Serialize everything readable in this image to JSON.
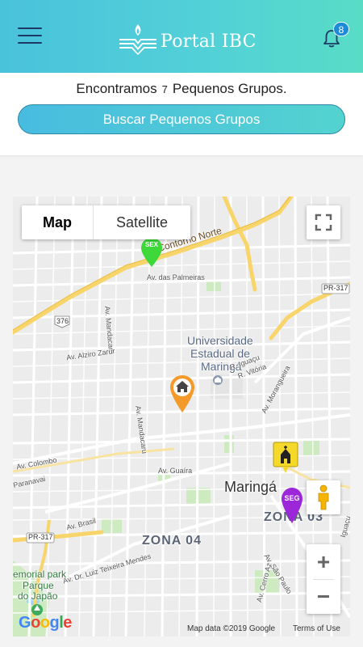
{
  "header": {
    "app_title": "Portal IBC",
    "notification_count": "8",
    "menu_icon": "hamburger-menu-icon",
    "bell_icon": "bell-icon"
  },
  "summary": {
    "prefix": "Encontramos",
    "count": "7",
    "suffix": "Pequenos Grupos."
  },
  "search_button": "Buscar Pequenos Grupos",
  "map": {
    "type_options": [
      "Map",
      "Satellite"
    ],
    "selected_type": "Map",
    "markers": [
      {
        "label": "SEX",
        "color": "#3ed83a"
      },
      {
        "label": "SEG",
        "color": "#9c27d9"
      },
      {
        "icon": "home-icon",
        "color": "#f39a2a"
      },
      {
        "icon": "church-icon",
        "color": "#f4d92a"
      }
    ],
    "labels": {
      "contorno_norte": "Contorno Norte",
      "palmeiras": "Av. das Palmeiras",
      "mandacaru_1": "Av. Mandacaru",
      "mandacaru_2": "Av. Mandacaru",
      "university": [
        "Universidade",
        "Estadual de",
        "Maringá"
      ],
      "iguacu": "R. Iguaçu",
      "vitoria": "R. Vitória",
      "morangueira": "Av. Morangueira",
      "alziro": "Av. Alziro Zarur",
      "guaiua": "Av. Guaíra",
      "colombo": "Av. Colombo",
      "paranavai": "Paranavai",
      "brasil": "Av. Brasil",
      "luiz_teixeira": "Av. Dr. Luiz Teixeira Mendes",
      "sao_paulo": "Av. São Paulo",
      "cerro_azul": "Av. Cerro Az",
      "city": "Maringá",
      "zona03": "ZONA 03",
      "zona04": "ZONA 04",
      "pr317_top": "PR-317",
      "pr317_bottom": "PR-317",
      "r376": "376",
      "parque": [
        "emorial park",
        "Parque",
        "do Japão"
      ],
      "iguacu_side": "Iguaçu"
    },
    "attribution": "Map data ©2019 Google",
    "terms": "Terms of Use",
    "google_logo": "Google",
    "zoom_in": "+",
    "zoom_out": "−",
    "fullscreen_icon": "fullscreen-icon",
    "pegman_icon": "street-view-pegman-icon",
    "colors": {
      "yellow_road": "#f7d56a",
      "white_road": "#ffffff",
      "green_area": "#cdeac0",
      "water": "#9fd3ef"
    }
  }
}
